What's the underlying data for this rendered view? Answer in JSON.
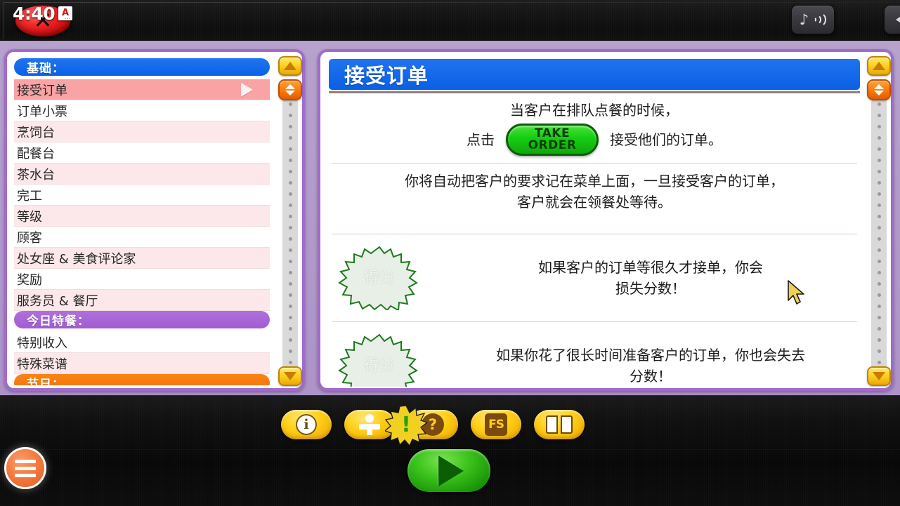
{
  "topbar": {
    "clock": "4:40",
    "a_badge_letter": "A",
    "a_badge_dots": "...",
    "close_label": "✕",
    "music_icon": "music-note-waves-icon",
    "volume_icon": "speaker-waves-icon",
    "wifi_icon": "wifi-signal-icon",
    "battery_icon": "battery-charging-icon",
    "battery_glyph": "⚡"
  },
  "sidebar": {
    "items": [
      {
        "label": "基础：",
        "type": "header-blue"
      },
      {
        "label": "接受订单",
        "type": "row",
        "state": "active"
      },
      {
        "label": "订单小票",
        "type": "row",
        "state": "white"
      },
      {
        "label": "烹饲台",
        "type": "row",
        "state": "alt"
      },
      {
        "label": "配餐台",
        "type": "row",
        "state": "white"
      },
      {
        "label": "茶水台",
        "type": "row",
        "state": "alt"
      },
      {
        "label": "完工",
        "type": "row",
        "state": "white"
      },
      {
        "label": "等级",
        "type": "row",
        "state": "alt"
      },
      {
        "label": "顾客",
        "type": "row",
        "state": "white"
      },
      {
        "label": "处女座 & 美食评论家",
        "type": "row",
        "state": "alt"
      },
      {
        "label": "奖励",
        "type": "row",
        "state": "white"
      },
      {
        "label": "服务员 & 餐厅",
        "type": "row",
        "state": "alt"
      },
      {
        "label": "今日特餐：",
        "type": "header-purple"
      },
      {
        "label": "特别收入",
        "type": "row",
        "state": "white"
      },
      {
        "label": "特殊菜谱",
        "type": "row",
        "state": "alt"
      },
      {
        "label": "节日：",
        "type": "header-orange"
      }
    ],
    "selected_marker": "play-triangle"
  },
  "scrollbar": {
    "up_label": "▲",
    "down_label": "▼",
    "thumb_label": "drag-thumb"
  },
  "document": {
    "title": "接受订单",
    "line1": "当客户在排队点餐的时候，",
    "click_word": "点击",
    "take_order_top": "TAKE",
    "take_order_bottom": "ORDER",
    "after_button": "接受他们的订单。",
    "para2_line1": "你将自动把客户的要求记在菜单上面，一旦接受客户的订单，",
    "para2_line2": "客户就会在领餐处等待。",
    "note1": {
      "badge_text": "得分",
      "line1": "如果客户的订单等很久才接单，你会",
      "line2": "损失分数！"
    },
    "note2": {
      "badge_text": "得分",
      "line1": "如果你花了很长时间准备客户的订单，你也会失去",
      "line2": "分数！"
    }
  },
  "toolbar": {
    "buttons": [
      {
        "name": "info-button",
        "icon": "info-circle-icon",
        "glyph": "i"
      },
      {
        "name": "character-button",
        "icon": "person-icon",
        "glyph": ""
      },
      {
        "name": "help-button",
        "icon": "question-mark-icon",
        "glyph": "?"
      },
      {
        "name": "fs-logo-button",
        "icon": "fs-logo-icon",
        "glyph": "F"
      },
      {
        "name": "book-button",
        "icon": "open-book-icon",
        "glyph": ""
      }
    ],
    "fs_top": "F",
    "fs_bottom": "S",
    "alert_glyph": "!",
    "alert_icon": "alert-starburst-icon"
  },
  "bottom": {
    "menu_icon": "hamburger-menu-icon",
    "play_icon": "play-triangle-icon"
  },
  "cursor": {
    "icon": "mouse-pointer-icon"
  },
  "colors": {
    "panel_border": "#a06cc9",
    "header_blue": "#0b5fe4",
    "header_purple": "#a05cd2",
    "header_orange": "#f37306",
    "row_active": "#f9a3a5",
    "row_alt": "#fce8ea",
    "accent_yellow": "#ffd017",
    "accent_orange": "#fd7e0b",
    "play_green": "#3ec41e",
    "background_purple": "#ad93c8"
  }
}
